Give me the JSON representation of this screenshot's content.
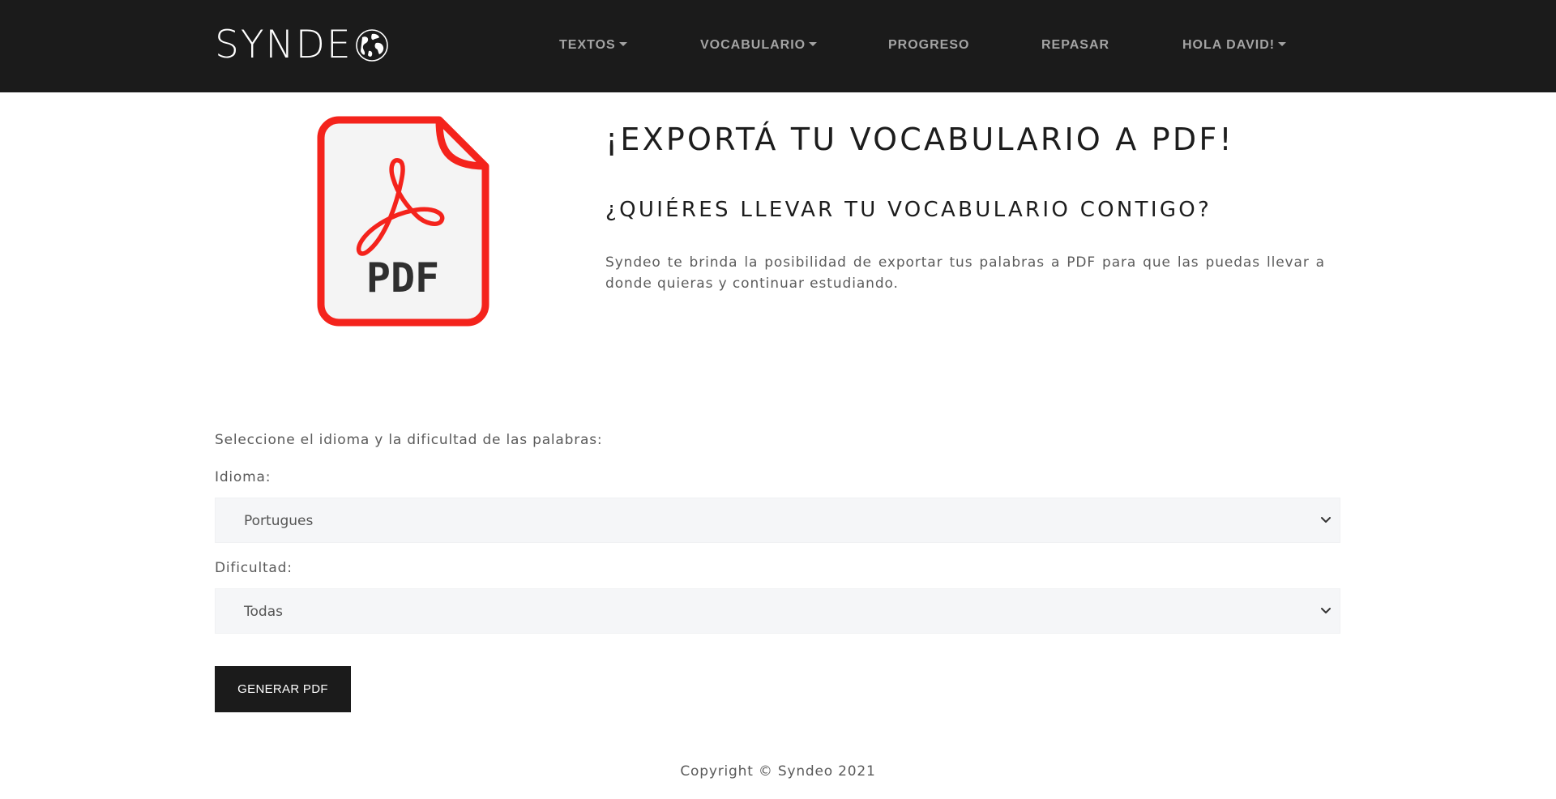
{
  "navbar": {
    "brand": "SYNDE",
    "brand_icon": "globe-icon",
    "items": [
      {
        "label": "TEXTOS",
        "dropdown": true
      },
      {
        "label": "VOCABULARIO",
        "dropdown": true
      },
      {
        "label": "PROGRESO",
        "dropdown": false
      },
      {
        "label": "REPASAR",
        "dropdown": false
      },
      {
        "label": "HOLA DAVID!",
        "dropdown": true
      }
    ],
    "background": "#1b1b1b",
    "text_color": "#a4a4a4"
  },
  "hero": {
    "icon": "pdf-file-icon",
    "icon_label": "PDF",
    "icon_color": "#f4231c",
    "title": "¡EXPORTÁ TU VOCABULARIO A PDF!",
    "subtitle": "¿QUIÉRES LLEVAR TU VOCABULARIO CONTIGO?",
    "text": "Syndeo te brinda la posibilidad de exportar tus palabras a PDF para que las puedas llevar a donde quieras y continuar estudiando."
  },
  "form": {
    "intro": "Seleccione el idioma y la dificultad de las palabras:",
    "language_label": "Idioma:",
    "language_value": "Portugues",
    "difficulty_label": "Dificultad:",
    "difficulty_value": "Todas",
    "submit_label": "GENERAR PDF"
  },
  "footer": {
    "copyright": "Copyright © Syndeo 2021"
  }
}
